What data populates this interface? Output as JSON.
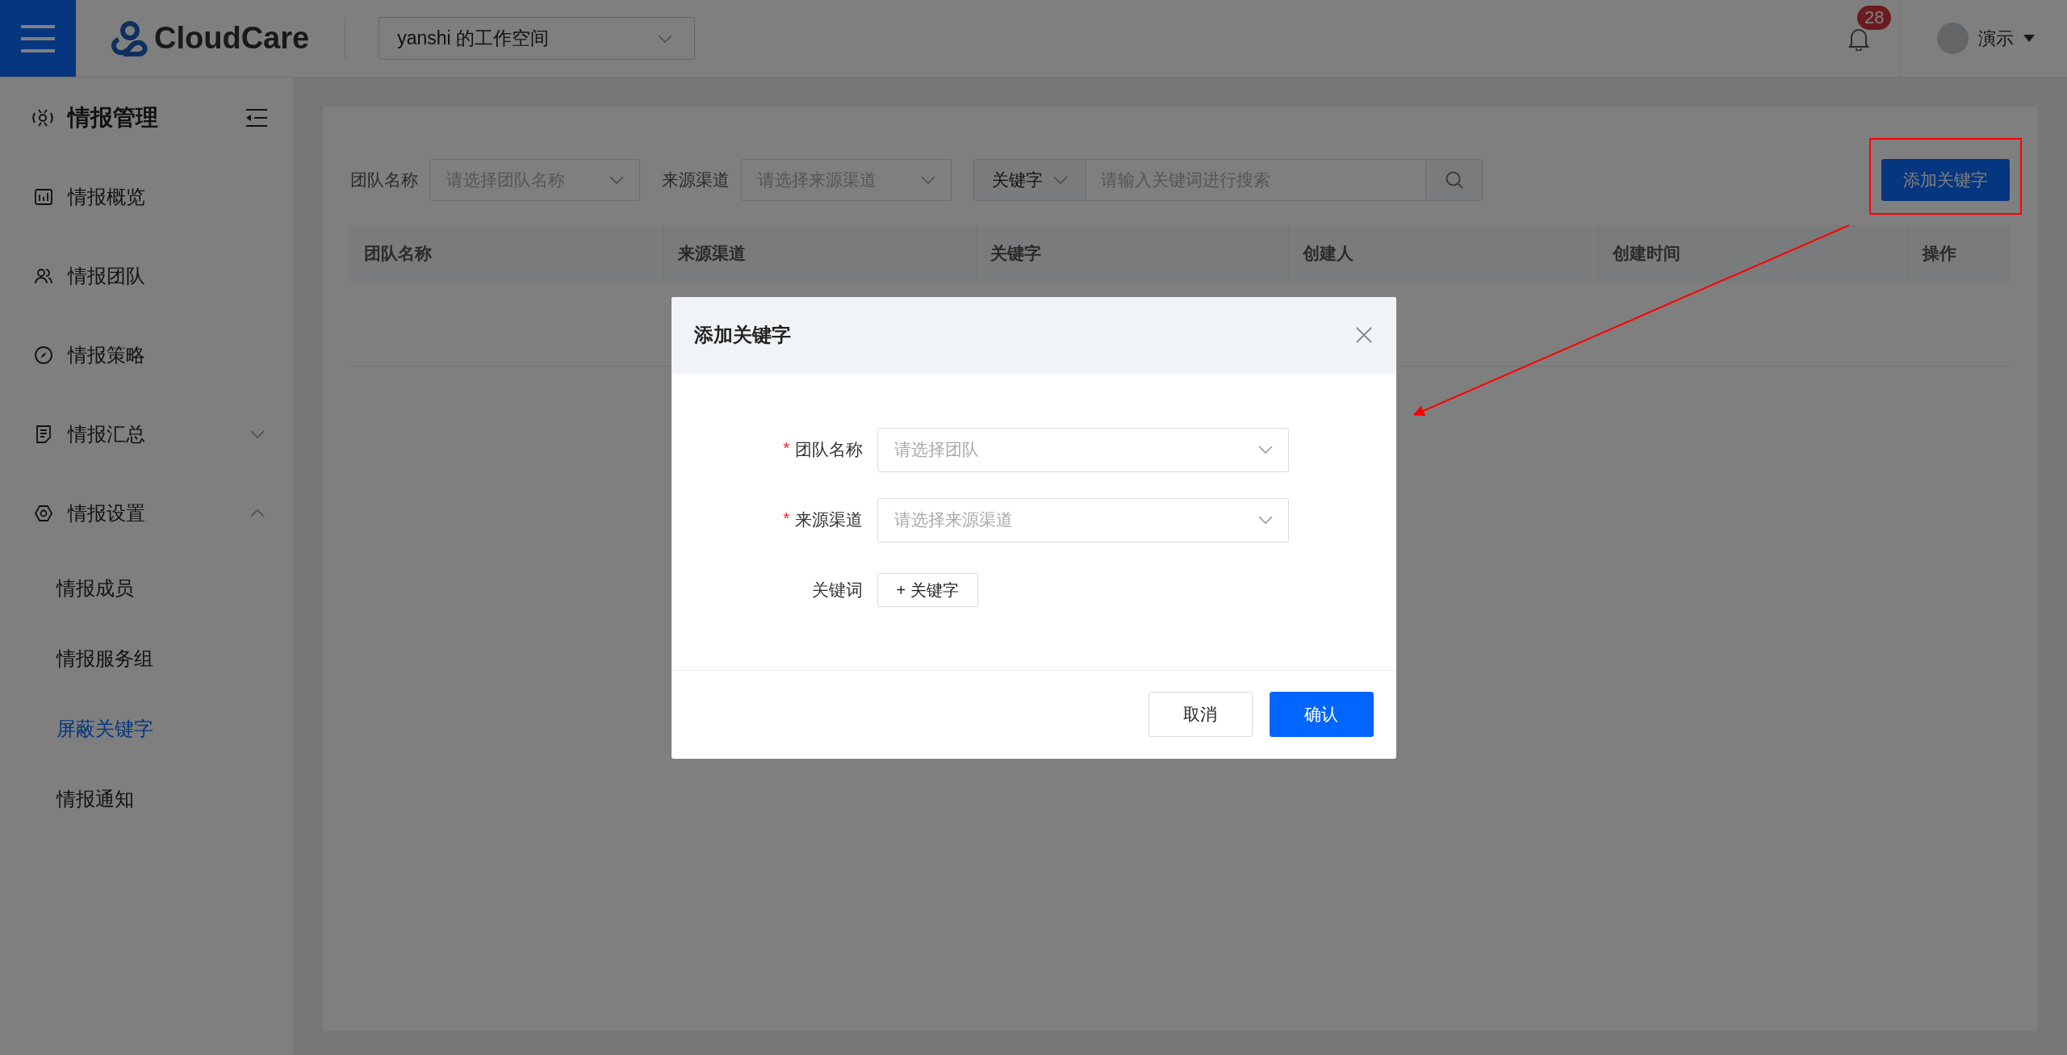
{
  "topbar": {
    "logo": "CloudCare",
    "workspace": "yanshi 的工作空间",
    "notifications": "28",
    "user": "演示"
  },
  "sidebar": {
    "title": "情报管理",
    "items": [
      {
        "label": "情报概览"
      },
      {
        "label": "情报团队"
      },
      {
        "label": "情报策略"
      },
      {
        "label": "情报汇总",
        "expanded": false
      },
      {
        "label": "情报设置",
        "expanded": true,
        "children": [
          {
            "label": "情报成员",
            "selected": false
          },
          {
            "label": "情报服务组",
            "selected": false
          },
          {
            "label": "屏蔽关键字",
            "selected": true
          },
          {
            "label": "情报通知",
            "selected": false
          }
        ]
      }
    ]
  },
  "filters": [
    {
      "label": "团队名称",
      "placeholder": "请选择团队名称"
    },
    {
      "label": "来源渠道",
      "placeholder": "请选择来源渠道"
    }
  ],
  "search": {
    "scope": "关键字",
    "placeholder": "请输入关键词进行搜索"
  },
  "add_button": "添加关键字",
  "table": {
    "columns": [
      "团队名称",
      "来源渠道",
      "关键字",
      "创建人",
      "创建时间",
      "操作"
    ]
  },
  "dialog": {
    "title": "添加关键字",
    "fields": [
      {
        "kind": "select",
        "label": "团队名称",
        "required_mark": "*",
        "placeholder": "请选择团队"
      },
      {
        "kind": "select",
        "label": "来源渠道",
        "required_mark": "*",
        "placeholder": "请选择来源渠道"
      },
      {
        "kind": "add",
        "label": "关键词",
        "button": "+ 关键字"
      }
    ],
    "buttons": [
      {
        "label": "取消",
        "primary": false
      },
      {
        "label": "确认",
        "primary": true
      }
    ]
  }
}
